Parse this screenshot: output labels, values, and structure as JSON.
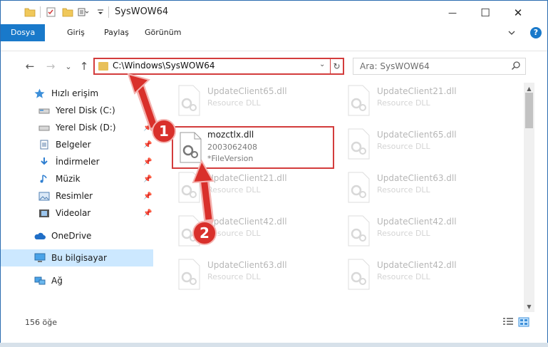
{
  "window": {
    "title": "SysWOW64",
    "minimize_glyph": "—",
    "maximize_glyph": "☐",
    "close_glyph": "✕"
  },
  "ribbon": {
    "tabs": [
      "Dosya",
      "Giriş",
      "Paylaş",
      "Görünüm"
    ],
    "help_glyph": "?"
  },
  "navigation": {
    "back_glyph": "←",
    "forward_glyph": "→",
    "recent_glyph": "⌄",
    "up_glyph": "↑",
    "address": "C:\\Windows\\SysWOW64",
    "dropdown_glyph": "⌄",
    "refresh_glyph": "↻",
    "search_placeholder": "Ara: SysWOW64"
  },
  "sidebar": {
    "items": [
      {
        "label": "Hızlı erişim",
        "icon": "star-icon"
      },
      {
        "label": "Yerel Disk (C:)",
        "icon": "drive-icon",
        "pinned": true
      },
      {
        "label": "Yerel Disk (D:)",
        "icon": "drive-icon",
        "pinned": true
      },
      {
        "label": "Belgeler",
        "icon": "documents-icon",
        "pinned": true
      },
      {
        "label": "İndirmeler",
        "icon": "download-icon",
        "pinned": true
      },
      {
        "label": "Müzik",
        "icon": "music-icon",
        "pinned": true
      },
      {
        "label": "Resimler",
        "icon": "pictures-icon",
        "pinned": true
      },
      {
        "label": "Videolar",
        "icon": "videos-icon",
        "pinned": true
      },
      {
        "label": "OneDrive",
        "icon": "cloud-icon"
      },
      {
        "label": "Bu bilgisayar",
        "icon": "computer-icon",
        "selected": true
      },
      {
        "label": "Ağ",
        "icon": "network-icon"
      }
    ]
  },
  "files": [
    {
      "name": "UpdateClient65.dll",
      "desc": "Resource DLL"
    },
    {
      "name": "UpdateClient21.dll",
      "desc": "Resource DLL"
    },
    {
      "name": "mozctlx.dll",
      "desc": "2003062408",
      "version": "*FileVersion"
    },
    {
      "name": "UpdateClient65.dll",
      "desc": "Resource DLL"
    },
    {
      "name": "UpdateClient21.dll",
      "desc": "Resource DLL"
    },
    {
      "name": "UpdateClient63.dll",
      "desc": "Resource DLL"
    },
    {
      "name": "UpdateClient42.dll",
      "desc": "Resource DLL"
    },
    {
      "name": "UpdateClient42.dll",
      "desc": "Resource DLL"
    },
    {
      "name": "UpdateClient63.dll",
      "desc": "Resource DLL"
    },
    {
      "name": "UpdateClient42.dll",
      "desc": "Resource DLL"
    }
  ],
  "status": {
    "item_count": "156 öğe"
  },
  "annotations": {
    "step1": "1",
    "step2": "2",
    "color": "#d9302b"
  }
}
